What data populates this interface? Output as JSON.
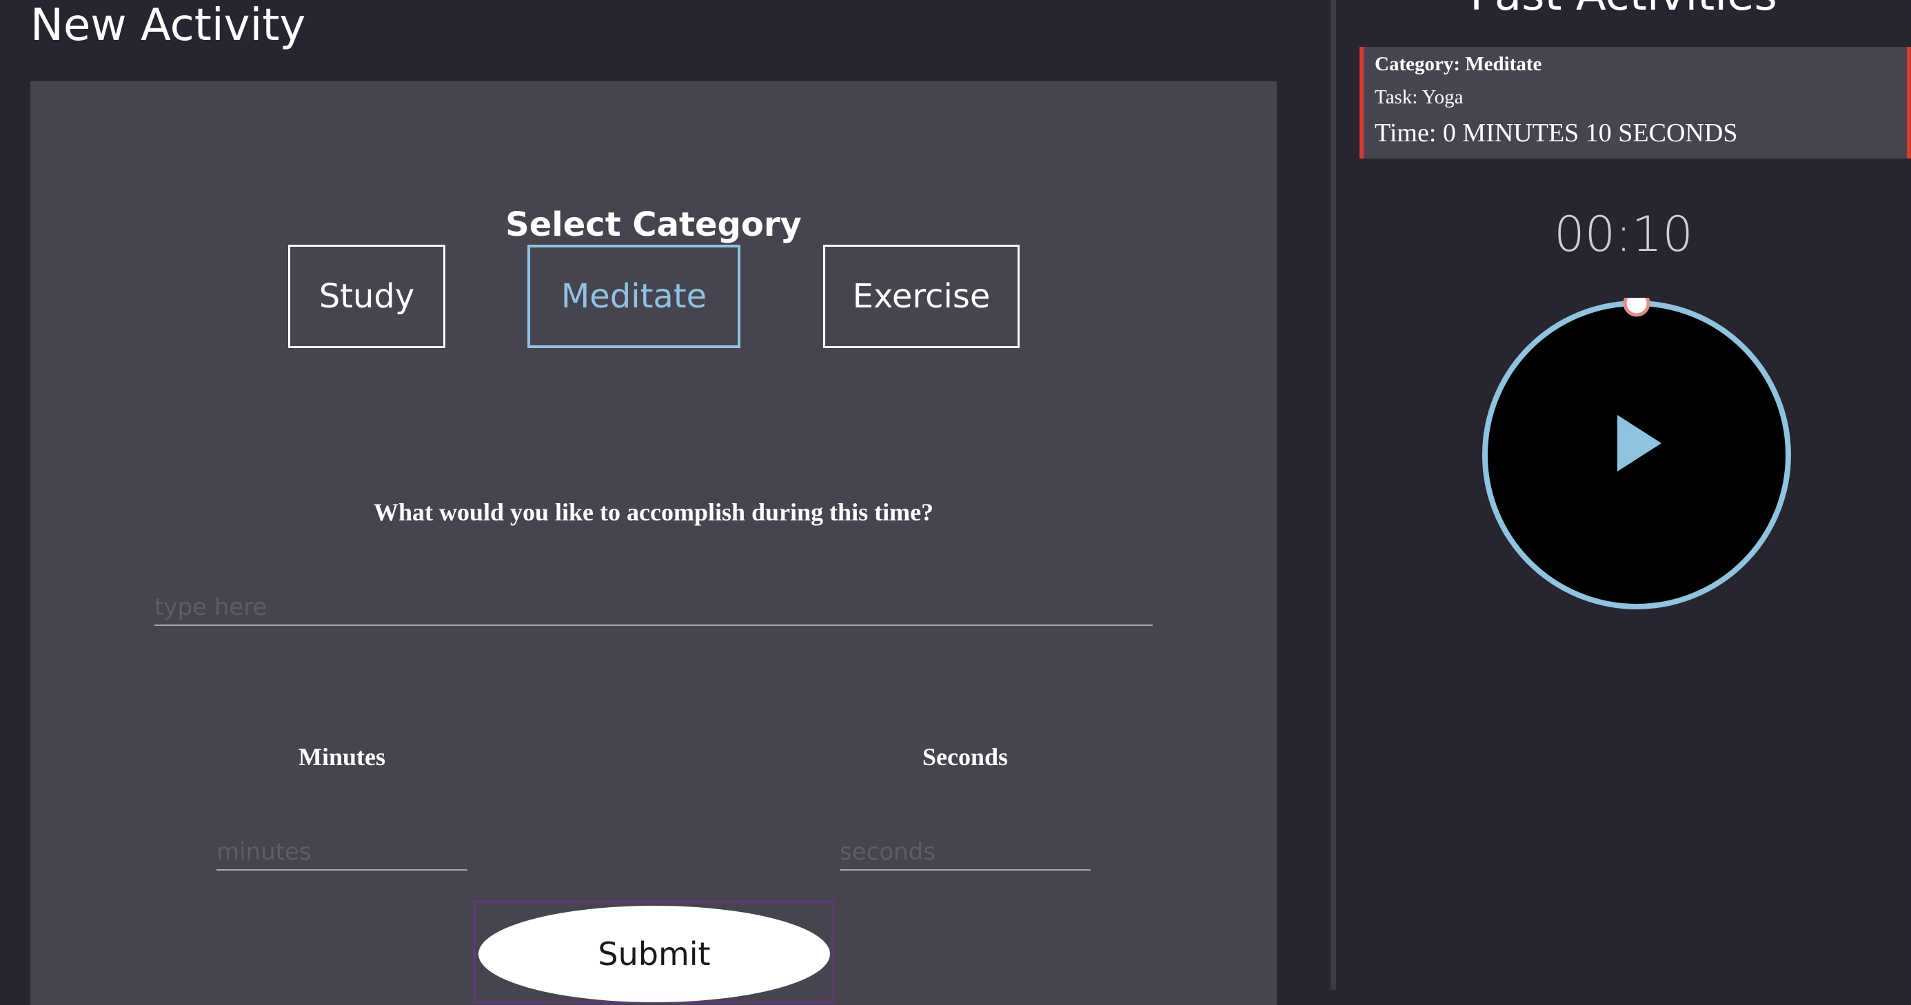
{
  "new_activity": {
    "title": "New Activity",
    "select_category_title": "Select Category",
    "categories": [
      {
        "label": "Study",
        "selected": false
      },
      {
        "label": "Meditate",
        "selected": true
      },
      {
        "label": "Exercise",
        "selected": false
      }
    ],
    "question": "What would you like to accomplish during this time?",
    "task_input": {
      "value": "",
      "placeholder": "type here"
    },
    "minutes": {
      "label": "Minutes",
      "value": "",
      "placeholder": "minutes"
    },
    "seconds": {
      "label": "Seconds",
      "value": "",
      "placeholder": "seconds"
    },
    "submit_label": "Submit"
  },
  "past_activities": {
    "title": "Past Activities",
    "items": [
      {
        "category": "Category: Meditate",
        "task": "Task: Yoga",
        "time": "Time: 0 MINUTES 10 SECONDS"
      }
    ]
  },
  "timer": {
    "display": "00:10",
    "state": "paused",
    "progress": 0
  },
  "colors": {
    "background": "#27252f",
    "panel": "#46444e",
    "accent_selected": "#8ec3e2",
    "card_border": "#d83a33",
    "timer_ring": "#8ec3e2",
    "timer_knob": "#e58d83"
  },
  "icons": {
    "play": "play-icon"
  }
}
